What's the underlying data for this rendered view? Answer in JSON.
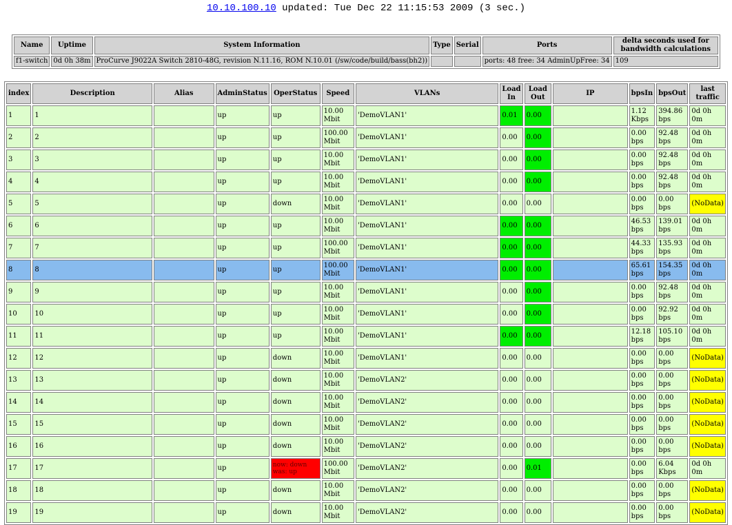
{
  "header": {
    "host_link": "10.10.100.10",
    "updated_text": " updated: Tue Dec 22 11:15:53 2009 (3 sec.)"
  },
  "sysinfo": {
    "headers": [
      "Name",
      "Uptime",
      "System Information",
      "Type",
      "Serial",
      "Ports",
      "delta seconds used for bandwidth calculations"
    ],
    "values": [
      "f1-switch",
      "0d 0h 38m",
      "ProCurve J9022A Switch 2810-48G, revision N.11.16, ROM N.10.01 (/sw/code/build/bass(bh2))",
      "",
      "",
      "ports: 48 free: 34 AdminUpFree: 34",
      "109"
    ]
  },
  "ports": {
    "headers": [
      "index",
      "Description",
      "Alias",
      "AdminStatus",
      "OperStatus",
      "Speed",
      "VLANs",
      "Load In",
      "Load Out",
      "IP",
      "bpsIn",
      "bpsOut",
      "last traffic"
    ],
    "rows": [
      {
        "index": "1",
        "desc": "1",
        "alias": "",
        "admin": "up",
        "oper": "up",
        "speed": "10.00 Mbit",
        "vlans": "'DemoVLAN1'",
        "load_in": "0.01",
        "load_out": "0.00",
        "ip": "",
        "bps_in": "1.12 Kbps",
        "bps_out": "394.86 bps",
        "last": "0d 0h 0m",
        "in_hl": true,
        "out_hl": true
      },
      {
        "index": "2",
        "desc": "2",
        "alias": "",
        "admin": "up",
        "oper": "up",
        "speed": "100.00 Mbit",
        "vlans": "'DemoVLAN1'",
        "load_in": "0.00",
        "load_out": "0.00",
        "ip": "",
        "bps_in": "0.00 bps",
        "bps_out": "92.48 bps",
        "last": "0d 0h 0m",
        "out_hl": true
      },
      {
        "index": "3",
        "desc": "3",
        "alias": "",
        "admin": "up",
        "oper": "up",
        "speed": "10.00 Mbit",
        "vlans": "'DemoVLAN1'",
        "load_in": "0.00",
        "load_out": "0.00",
        "ip": "",
        "bps_in": "0.00 bps",
        "bps_out": "92.48 bps",
        "last": "0d 0h 0m",
        "out_hl": true
      },
      {
        "index": "4",
        "desc": "4",
        "alias": "",
        "admin": "up",
        "oper": "up",
        "speed": "10.00 Mbit",
        "vlans": "'DemoVLAN1'",
        "load_in": "0.00",
        "load_out": "0.00",
        "ip": "",
        "bps_in": "0.00 bps",
        "bps_out": "92.48 bps",
        "last": "0d 0h 0m",
        "out_hl": true
      },
      {
        "index": "5",
        "desc": "5",
        "alias": "",
        "admin": "up",
        "oper": "down",
        "speed": "10.00 Mbit",
        "vlans": "'DemoVLAN1'",
        "load_in": "0.00",
        "load_out": "0.00",
        "ip": "",
        "bps_in": "0.00 bps",
        "bps_out": "0.00 bps",
        "last": "(NoData)",
        "nodata": true
      },
      {
        "index": "6",
        "desc": "6",
        "alias": "",
        "admin": "up",
        "oper": "up",
        "speed": "10.00 Mbit",
        "vlans": "'DemoVLAN1'",
        "load_in": "0.00",
        "load_out": "0.00",
        "ip": "",
        "bps_in": "46.53 bps",
        "bps_out": "139.01 bps",
        "last": "0d 0h 0m",
        "in_hl": true,
        "out_hl": true
      },
      {
        "index": "7",
        "desc": "7",
        "alias": "",
        "admin": "up",
        "oper": "up",
        "speed": "100.00 Mbit",
        "vlans": "'DemoVLAN1'",
        "load_in": "0.00",
        "load_out": "0.00",
        "ip": "",
        "bps_in": "44.33 bps",
        "bps_out": "135.93 bps",
        "last": "0d 0h 0m",
        "in_hl": true,
        "out_hl": true
      },
      {
        "index": "8",
        "desc": "8",
        "alias": "",
        "admin": "up",
        "oper": "up",
        "speed": "100.00 Mbit",
        "vlans": "'DemoVLAN1'",
        "load_in": "0.00",
        "load_out": "0.00",
        "ip": "",
        "bps_in": "65.61 bps",
        "bps_out": "154.35 bps",
        "last": "0d 0h 0m",
        "in_hl": true,
        "out_hl": true,
        "selected": true
      },
      {
        "index": "9",
        "desc": "9",
        "alias": "",
        "admin": "up",
        "oper": "up",
        "speed": "10.00 Mbit",
        "vlans": "'DemoVLAN1'",
        "load_in": "0.00",
        "load_out": "0.00",
        "ip": "",
        "bps_in": "0.00 bps",
        "bps_out": "92.48 bps",
        "last": "0d 0h 0m",
        "out_hl": true
      },
      {
        "index": "10",
        "desc": "10",
        "alias": "",
        "admin": "up",
        "oper": "up",
        "speed": "10.00 Mbit",
        "vlans": "'DemoVLAN1'",
        "load_in": "0.00",
        "load_out": "0.00",
        "ip": "",
        "bps_in": "0.00 bps",
        "bps_out": "92.92 bps",
        "last": "0d 0h 0m",
        "out_hl": true
      },
      {
        "index": "11",
        "desc": "11",
        "alias": "",
        "admin": "up",
        "oper": "up",
        "speed": "10.00 Mbit",
        "vlans": "'DemoVLAN1'",
        "load_in": "0.00",
        "load_out": "0.00",
        "ip": "",
        "bps_in": "12.18 bps",
        "bps_out": "105.10 bps",
        "last": "0d 0h 0m",
        "in_hl": true,
        "out_hl": true
      },
      {
        "index": "12",
        "desc": "12",
        "alias": "",
        "admin": "up",
        "oper": "down",
        "speed": "10.00 Mbit",
        "vlans": "'DemoVLAN1'",
        "load_in": "0.00",
        "load_out": "0.00",
        "ip": "",
        "bps_in": "0.00 bps",
        "bps_out": "0.00 bps",
        "last": "(NoData)",
        "nodata": true
      },
      {
        "index": "13",
        "desc": "13",
        "alias": "",
        "admin": "up",
        "oper": "down",
        "speed": "10.00 Mbit",
        "vlans": "'DemoVLAN2'",
        "load_in": "0.00",
        "load_out": "0.00",
        "ip": "",
        "bps_in": "0.00 bps",
        "bps_out": "0.00 bps",
        "last": "(NoData)",
        "nodata": true
      },
      {
        "index": "14",
        "desc": "14",
        "alias": "",
        "admin": "up",
        "oper": "down",
        "speed": "10.00 Mbit",
        "vlans": "'DemoVLAN2'",
        "load_in": "0.00",
        "load_out": "0.00",
        "ip": "",
        "bps_in": "0.00 bps",
        "bps_out": "0.00 bps",
        "last": "(NoData)",
        "nodata": true
      },
      {
        "index": "15",
        "desc": "15",
        "alias": "",
        "admin": "up",
        "oper": "down",
        "speed": "10.00 Mbit",
        "vlans": "'DemoVLAN2'",
        "load_in": "0.00",
        "load_out": "0.00",
        "ip": "",
        "bps_in": "0.00 bps",
        "bps_out": "0.00 bps",
        "last": "(NoData)",
        "nodata": true
      },
      {
        "index": "16",
        "desc": "16",
        "alias": "",
        "admin": "up",
        "oper": "down",
        "speed": "10.00 Mbit",
        "vlans": "'DemoVLAN2'",
        "load_in": "0.00",
        "load_out": "0.00",
        "ip": "",
        "bps_in": "0.00 bps",
        "bps_out": "0.00 bps",
        "last": "(NoData)",
        "nodata": true
      },
      {
        "index": "17",
        "desc": "17",
        "alias": "",
        "admin": "up",
        "oper": "now: down was: up",
        "speed": "100.00 Mbit",
        "vlans": "'DemoVLAN2'",
        "load_in": "0.00",
        "load_out": "0.01",
        "ip": "",
        "bps_in": "0.00 bps",
        "bps_out": "6.04 Kbps",
        "last": "0d 0h 0m",
        "out_hl": true,
        "oper_alert": true
      },
      {
        "index": "18",
        "desc": "18",
        "alias": "",
        "admin": "up",
        "oper": "down",
        "speed": "10.00 Mbit",
        "vlans": "'DemoVLAN2'",
        "load_in": "0.00",
        "load_out": "0.00",
        "ip": "",
        "bps_in": "0.00 bps",
        "bps_out": "0.00 bps",
        "last": "(NoData)",
        "nodata": true
      },
      {
        "index": "19",
        "desc": "19",
        "alias": "",
        "admin": "up",
        "oper": "down",
        "speed": "10.00 Mbit",
        "vlans": "'DemoVLAN2'",
        "load_in": "0.00",
        "load_out": "0.00",
        "ip": "",
        "bps_in": "0.00 bps",
        "bps_out": "0.00 bps",
        "last": "(NoData)",
        "nodata": true
      }
    ]
  },
  "colors": {
    "row_bg": "#ddfdcc",
    "selected_bg": "#88bbee",
    "load_highlight": "#00ee00",
    "nodata": "#ffff00",
    "alert": "#ff0000",
    "header_bg": "#d3d3d3"
  }
}
